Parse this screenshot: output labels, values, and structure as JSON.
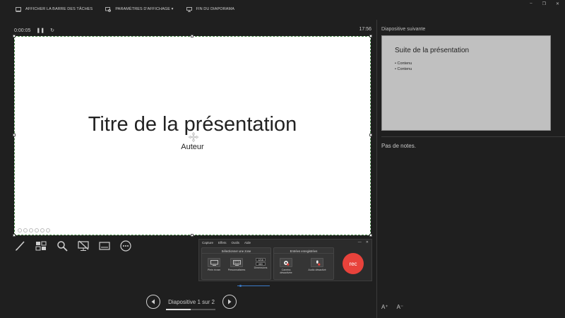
{
  "topbar": {
    "show_taskbar": "AFFICHER LA BARRE DES TÂCHES",
    "display_settings": "PARAMÈTRES D'AFFICHAGE ▾",
    "end_slideshow": "FIN DU DIAPORAMA",
    "icons": [
      "taskbar-icon",
      "display-settings-icon",
      "end-slideshow-icon"
    ]
  },
  "window_controls": {
    "minimize": "–",
    "restore": "❐",
    "close": "✕"
  },
  "timer": {
    "elapsed": "0:00:05",
    "pause": "❚❚",
    "reset": "↻",
    "clock": "17:56"
  },
  "slide": {
    "title": "Titre de la présentation",
    "subtitle": "Auteur"
  },
  "tools": [
    "pen-icon",
    "slide-grid-icon",
    "zoom-icon",
    "black-screen-icon",
    "subtitles-icon",
    "more-options-icon"
  ],
  "navigation": {
    "prev": "◀",
    "next": "▶",
    "label": "Diapositive 1 sur 2",
    "progress": 0.5
  },
  "next_slide": {
    "header": "Diapositive suivante",
    "title": "Suite de la présentation",
    "bullets": [
      "Contenu",
      "Contenu"
    ]
  },
  "notes": {
    "text": "Pas de notes."
  },
  "font_controls": {
    "increase": "A⁺",
    "decrease": "A⁻"
  },
  "recorder": {
    "menu": [
      "Capture",
      "Effets",
      "Outils",
      "Aide"
    ],
    "window_controls": {
      "minimize": "—",
      "close": "✕"
    },
    "zone_group": {
      "header": "Sélectionner une zone",
      "fullscreen": "Plein écran",
      "custom": "Personnalisées",
      "dimensions_label": "Dimensions",
      "width": "1216",
      "height": "683"
    },
    "inputs_group": {
      "header": "Entrées enregistrées",
      "camera": "Caméra désactivée",
      "audio": "Audio désactivé"
    },
    "rec_label": "rec",
    "colors": {
      "rec": "#e8423b",
      "accent": "#3a7ac8"
    }
  }
}
